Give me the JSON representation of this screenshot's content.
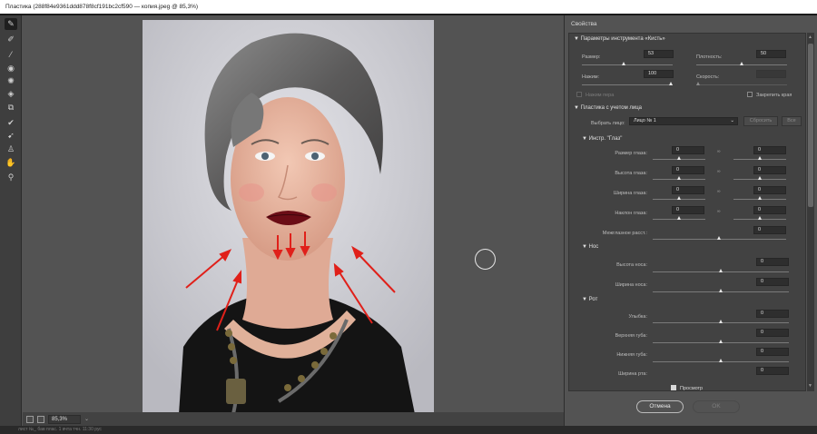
{
  "window": {
    "title": "Пластика (288f84e9361ddd878f8cf191bc2cf590 — копия.jpeg @ 85,3%)"
  },
  "tools": [
    {
      "name": "forward-warp-tool-icon",
      "glyph": "✎",
      "active": true
    },
    {
      "name": "reconstruct-tool-icon",
      "glyph": "✐"
    },
    {
      "name": "smooth-tool-icon",
      "glyph": "⁄"
    },
    {
      "name": "twirl-tool-icon",
      "glyph": "◉"
    },
    {
      "name": "pucker-tool-icon",
      "glyph": "✺"
    },
    {
      "name": "bloat-tool-icon",
      "glyph": "◈"
    },
    {
      "name": "push-left-tool-icon",
      "glyph": "⧉"
    },
    {
      "name": "freeze-mask-tool-icon",
      "glyph": "✔"
    },
    {
      "name": "thaw-mask-tool-icon",
      "glyph": "➹"
    },
    {
      "name": "face-tool-icon",
      "glyph": "♙"
    },
    {
      "name": "hand-tool-icon",
      "glyph": "✋"
    },
    {
      "name": "zoom-tool-icon",
      "glyph": "⚲"
    }
  ],
  "status": {
    "zoom": "85,3%",
    "bottom_text": "лист №_  бав плас. 1 вчта тчн. 11:30 рус"
  },
  "panel": {
    "title": "Свойства",
    "brush_section": "Параметры инструмента «Кисть»",
    "size_label": "Размер:",
    "size_value": "53",
    "density_label": "Плотность:",
    "density_value": "50",
    "pressure_label": "Нажим:",
    "pressure_value": "100",
    "rate_label": "Скорость:",
    "rate_value": "",
    "stylus_label": "Нажим пера",
    "pin_edges_label": "Закрепить края",
    "face_section": "Пластика с учетом лица",
    "select_face_label": "Выбрать лицо:",
    "select_face_value": "Лицо № 1",
    "reset_label": "Сбросить",
    "all_label": "Все",
    "eyes_section": "Инстр. \"Глаз\"",
    "eye_size_label": "Размер глаза:",
    "eye_height_label": "Высота глаза:",
    "eye_width_label": "Ширина глаза:",
    "eye_tilt_label": "Наклон глаза:",
    "eye_distance_label": "Межглазное расст.:",
    "nose_section": "Нос",
    "nose_height_label": "Высота носа:",
    "nose_width_label": "Ширина носа:",
    "mouth_section": "Рот",
    "smile_label": "Улыбка:",
    "upper_lip_label": "Верхняя губа:",
    "lower_lip_label": "Нижняя губа:",
    "mouth_width_label": "Ширина рта:",
    "zero": "0",
    "preview_label": "Просмотр",
    "cancel_label": "Отмена",
    "ok_label": "OK"
  },
  "colors": {
    "accent_arrow": "#e0201a"
  }
}
